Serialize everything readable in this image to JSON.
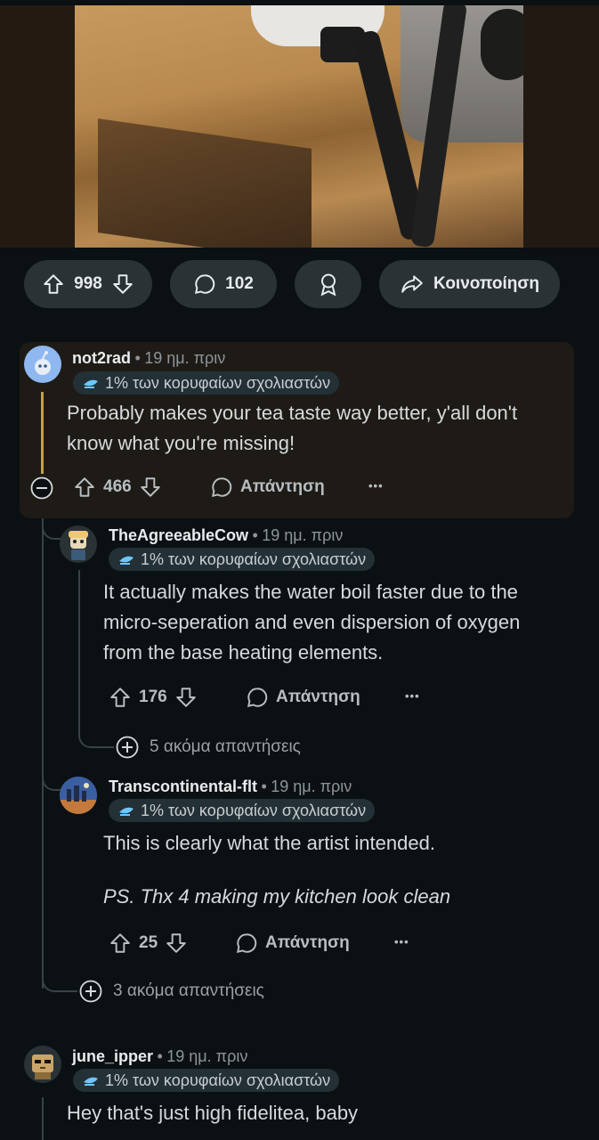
{
  "post": {
    "upvotes": "998",
    "comments": "102",
    "share_label": "Κοινοποίηση"
  },
  "comments": [
    {
      "author": "not2rad",
      "time": "19 ημ. πριν",
      "badge": "1% των κορυφαίων σχολιαστών",
      "lines": [
        "Probably makes your tea taste way better, y'all don't",
        "know what you're missing!"
      ],
      "votes": "466",
      "reply_label": "Απάντηση"
    },
    {
      "author": "TheAgreeableCow",
      "time": "19 ημ. πριν",
      "badge": "1% των κορυφαίων σχολιαστών",
      "lines": [
        "It actually makes the water boil faster due to the",
        "micro-seperation and even dispersion of oxygen",
        "from the base heating elements."
      ],
      "votes": "176",
      "reply_label": "Απάντηση",
      "more_replies": "5 ακόμα απαντήσεις"
    },
    {
      "author": "Transcontinental-flt",
      "time": "19 ημ. πριν",
      "badge": "1% των κορυφαίων σχολιαστών",
      "line1": "This is clearly what the artist intended.",
      "line2": "PS. Thx 4 making my kitchen look clean",
      "votes": "25",
      "reply_label": "Απάντηση"
    },
    {
      "author": "june_ipper",
      "time": "19 ημ. πριν",
      "badge": "1% των κορυφαίων σχολιαστών",
      "line1": "Hey that's just high fidelitea, baby"
    }
  ],
  "thread_more_replies": "3 ακόμα απαντήσεις",
  "separator": "•",
  "more_dots": "•••",
  "colors": {
    "background": "#0b1013",
    "pill": "#2a3236",
    "highlight": "#1e1b16",
    "accent_line": "#c5a24a"
  }
}
